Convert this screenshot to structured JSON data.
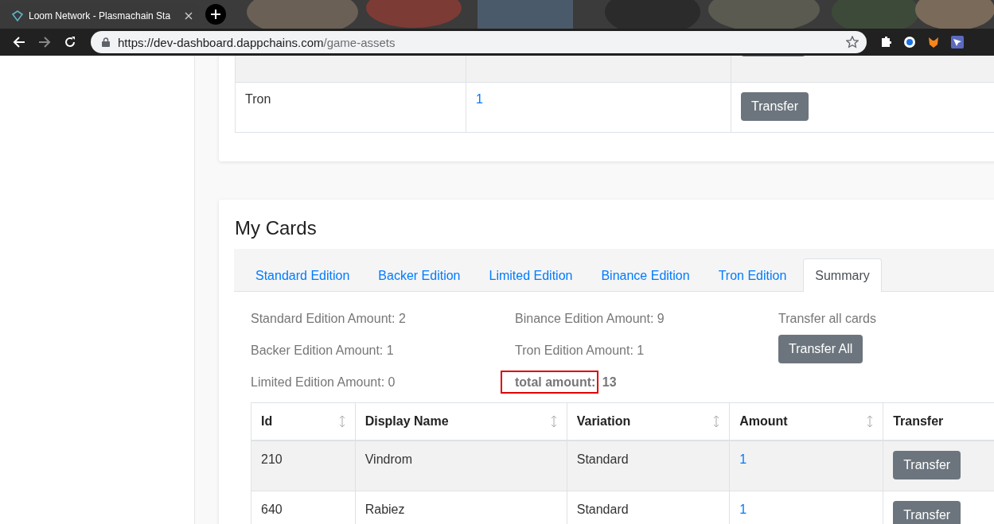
{
  "browser": {
    "tab_title": "Loom Network - Plasmachain Sta",
    "url_host": "https://dev-dashboard.dappchains.com",
    "url_path": "/game-assets"
  },
  "assets_table": {
    "rows": [
      {
        "name": "Tron",
        "amount": "1",
        "button": "Transfer"
      }
    ]
  },
  "cards": {
    "title": "My Cards",
    "tabs": [
      {
        "label": "Standard Edition",
        "selected": false
      },
      {
        "label": "Backer Edition",
        "selected": false
      },
      {
        "label": "Limited Edition",
        "selected": false
      },
      {
        "label": "Binance Edition",
        "selected": false
      },
      {
        "label": "Tron Edition",
        "selected": false
      },
      {
        "label": "Summary",
        "selected": true
      }
    ],
    "summary": {
      "items": [
        "Standard Edition Amount: 2",
        "Binance Edition Amount: 9",
        "Backer Edition Amount: 1",
        "Tron Edition Amount: 1",
        "Limited Edition Amount: 0"
      ],
      "total": {
        "label": "total amount:",
        "value": "13",
        "highlighted": true
      },
      "transfer_label": "Transfer all cards",
      "transfer_button": "Transfer All"
    },
    "table": {
      "columns": [
        {
          "label": "Id",
          "sortable": true
        },
        {
          "label": "Display Name",
          "sortable": true
        },
        {
          "label": "Variation",
          "sortable": true
        },
        {
          "label": "Amount",
          "sortable": true
        },
        {
          "label": "Transfer",
          "sortable": false
        }
      ],
      "rows": [
        {
          "cells": [
            "210",
            "Vindrom",
            "Standard",
            "1"
          ],
          "button": "Transfer"
        },
        {
          "cells": [
            "640",
            "Rabiez",
            "Standard",
            "1"
          ],
          "button": "Transfer"
        }
      ]
    }
  }
}
